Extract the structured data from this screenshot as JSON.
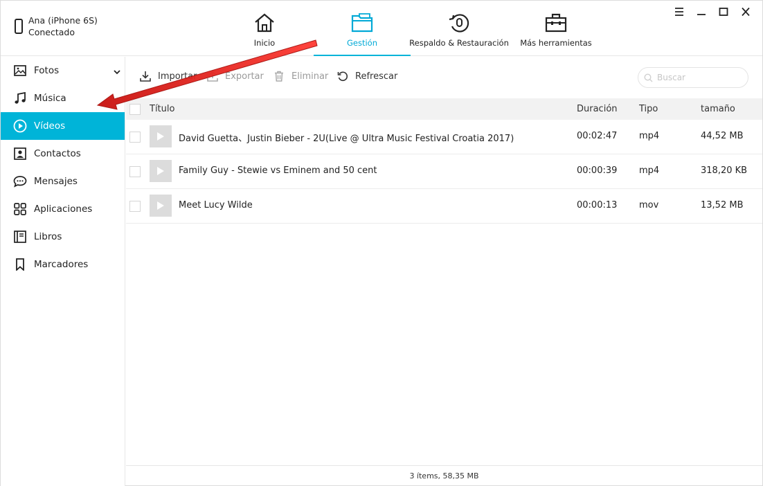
{
  "device": {
    "name": "Ana (iPhone 6S)",
    "status": "Conectado"
  },
  "nav": [
    {
      "label": "Inicio",
      "icon": "home-icon"
    },
    {
      "label": "Gestión",
      "icon": "folder-icon",
      "active": true
    },
    {
      "label": "Respaldo & Restauración",
      "icon": "backup-restore-icon"
    },
    {
      "label": "Más herramientas",
      "icon": "toolbox-icon"
    }
  ],
  "window_controls": [
    "menu-icon",
    "minimize-icon",
    "maximize-icon",
    "close-icon"
  ],
  "sidebar": {
    "items": [
      {
        "label": "Fotos",
        "icon": "photo-icon"
      },
      {
        "label": "Música",
        "icon": "music-icon"
      },
      {
        "label": "Vídeos",
        "icon": "play-circle-icon",
        "active": true
      },
      {
        "label": "Contactos",
        "icon": "contact-icon"
      },
      {
        "label": "Mensajes",
        "icon": "message-icon"
      },
      {
        "label": "Aplicaciones",
        "icon": "apps-icon"
      },
      {
        "label": "Libros",
        "icon": "book-icon"
      },
      {
        "label": "Marcadores",
        "icon": "bookmark-icon"
      }
    ]
  },
  "toolbar": {
    "import_label": "Importar",
    "export_label": "Exportar",
    "delete_label": "Eliminar",
    "refresh_label": "Refrescar",
    "search_placeholder": "Buscar"
  },
  "table": {
    "columns": {
      "title": "Título",
      "duration": "Duración",
      "type": "Tipo",
      "size": "tamaño"
    },
    "rows": [
      {
        "title": "David Guetta、Justin Bieber - 2U(Live @ Ultra Music Festival Croatia 2017)",
        "duration": "00:02:47",
        "type": "mp4",
        "size": "44,52 MB"
      },
      {
        "title": "Family Guy - Stewie vs Eminem and 50 cent",
        "duration": "00:00:39",
        "type": "mp4",
        "size": "318,20 KB"
      },
      {
        "title": "Meet Lucy Wilde",
        "duration": "00:00:13",
        "type": "mov",
        "size": "13,52 MB"
      }
    ]
  },
  "status": {
    "summary": "3 ítems, 58,35 MB"
  },
  "colors": {
    "accent": "#00b4d8",
    "arrow": "#e8201e"
  }
}
